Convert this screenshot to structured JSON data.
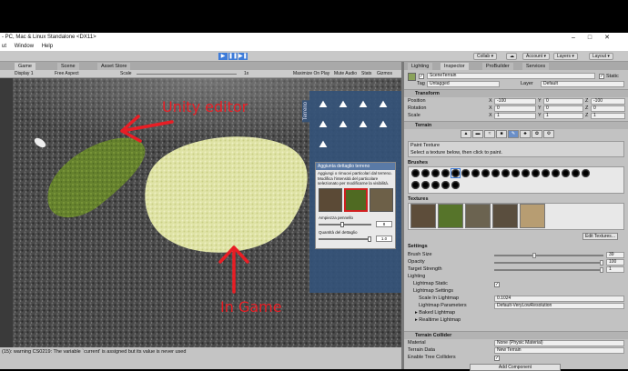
{
  "window": {
    "title": "- PC, Mac & Linux Standalone <DX11>"
  },
  "menu": {
    "items": [
      "ut",
      "Window",
      "Help"
    ]
  },
  "toolbar": {
    "collab": "Collab",
    "account": "Account",
    "layers": "Layers",
    "layout": "Layout"
  },
  "tabs": {
    "game": "Game",
    "scene": "Scene",
    "asset_store": "Asset Store"
  },
  "gamebar": {
    "display": "Display 1",
    "aspect": "Free Aspect",
    "scale_label": "Scale",
    "scale_value": "1x",
    "maximize": "Maximize On Play",
    "mute": "Mute Audio",
    "stats": "Stats",
    "gizmos": "Gizmos"
  },
  "annotations": {
    "top": "Unity editor",
    "bottom": "In Game"
  },
  "overlay": {
    "tab_label": "Terreno",
    "panel_title": "Aggiunta dettaglio terreno",
    "panel_desc": "Aggiungi o rimuovi particolari dal terreno. Modifica l'intensità del particolare selezionato per modificarne la visibilità.",
    "amp_label": "Ampiezza pennello",
    "amp_value": "8",
    "density_label": "Quantità del dettaglio",
    "density_value": "1.0"
  },
  "inspector": {
    "tabs": [
      "Lighting",
      "Inspector",
      "ProBuilder",
      "Services"
    ],
    "object_name": "SceneTerrain",
    "static_label": "Static",
    "tag_label": "Tag",
    "tag_value": "Untagged",
    "layer_label": "Layer",
    "layer_value": "Default",
    "transform": {
      "title": "Transform",
      "position": {
        "label": "Position",
        "x": "-100",
        "y": "0",
        "z": "-100"
      },
      "rotation": {
        "label": "Rotation",
        "x": "0",
        "y": "0",
        "z": "0"
      },
      "scale": {
        "label": "Scale",
        "x": "1",
        "y": "1",
        "z": "1"
      }
    },
    "terrain": {
      "title": "Terrain",
      "tool_title": "Paint Texture",
      "tool_desc": "Select a texture below, then click to paint.",
      "brushes_label": "Brushes",
      "textures_label": "Textures",
      "edit_textures": "Edit Textures..."
    },
    "settings": {
      "title": "Settings",
      "brush_size": {
        "label": "Brush Size",
        "value": "39"
      },
      "opacity": {
        "label": "Opacity",
        "value": "100"
      },
      "target_strength": {
        "label": "Target Strength",
        "value": "1"
      }
    },
    "lighting": {
      "title": "Lighting",
      "lightmap_static": "Lightmap Static",
      "lightmap_settings": "Lightmap Settings",
      "scale_in_lightmap": "Scale In Lightmap",
      "scale_value": "0.1024",
      "lightmap_parameters": "Lightmap Parameters",
      "parameters_value": "Default-VeryLowResolution",
      "baked": "Baked Lightmap",
      "realtime": "Realtime Lightmap"
    },
    "collider": {
      "title": "Terrain Collider",
      "material_label": "Material",
      "material_value": "None (Physic Material)",
      "data_label": "Terrain Data",
      "data_value": "New Terrain",
      "trees_label": "Enable Tree Colliders",
      "add_component": "Add Component"
    }
  },
  "console": {
    "message": "(15): warning CS0219: The variable `current' is assigned but its value is never used"
  },
  "colors": {
    "play_blue": "#3d7bd9",
    "annotation_red": "#e81e25",
    "overlay_blue": "#345278"
  },
  "icons": [
    "unity-logo-icon",
    "play-icon",
    "pause-icon",
    "step-icon",
    "cloud-icon",
    "gear-icon",
    "terrain-tool-icon"
  ]
}
